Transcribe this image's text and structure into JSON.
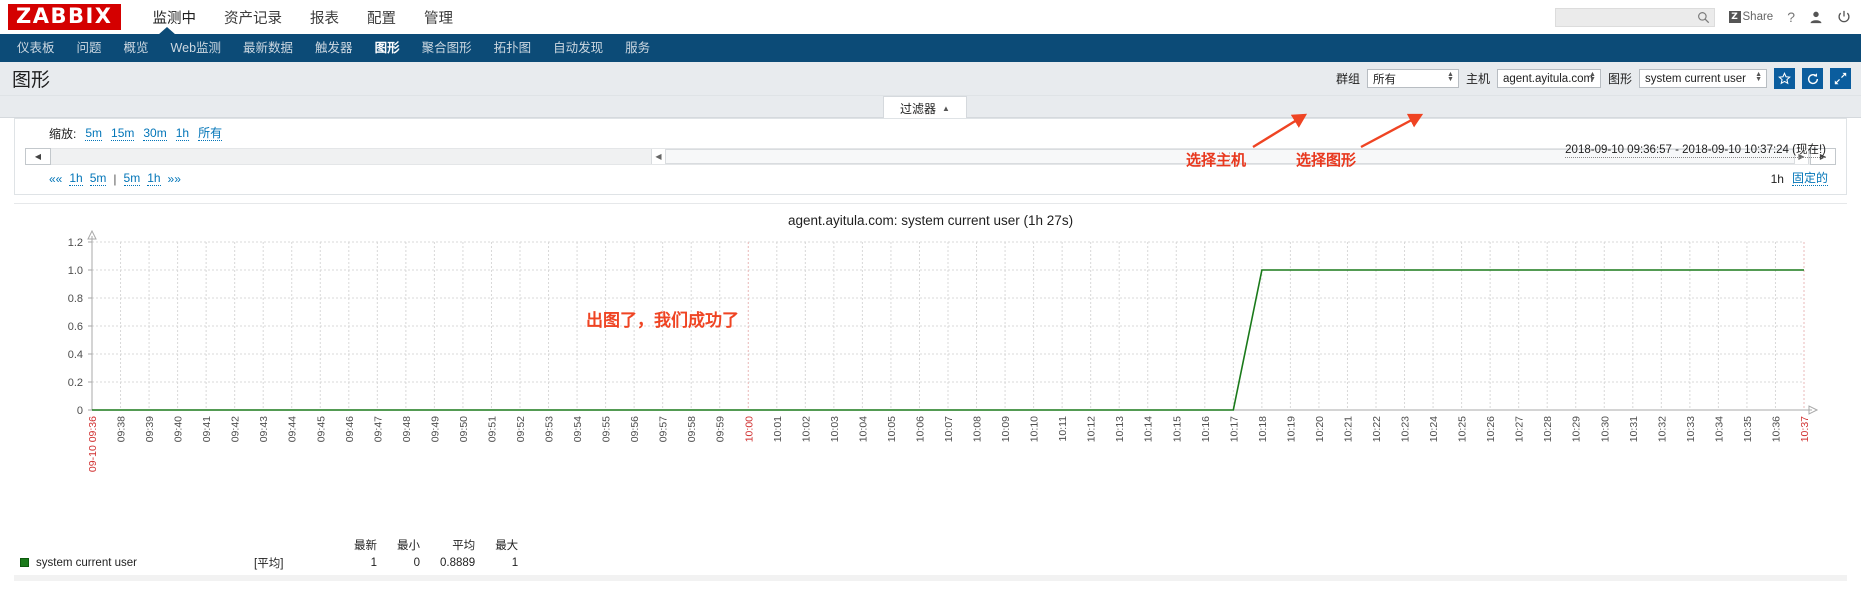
{
  "header": {
    "logo": "ZABBIX",
    "menu": [
      {
        "label": "监测中",
        "active": true
      },
      {
        "label": "资产记录",
        "active": false
      },
      {
        "label": "报表",
        "active": false
      },
      {
        "label": "配置",
        "active": false
      },
      {
        "label": "管理",
        "active": false
      }
    ],
    "search": {
      "value": "",
      "placeholder": ""
    },
    "share_label": "Share",
    "share_badge": "Z",
    "help_label": "?",
    "icons": {
      "search": "search-icon",
      "user": "user-icon",
      "power": "power-icon"
    }
  },
  "subnav": {
    "items": [
      {
        "label": "仪表板",
        "active": false
      },
      {
        "label": "问题",
        "active": false
      },
      {
        "label": "概览",
        "active": false
      },
      {
        "label": "Web监测",
        "active": false
      },
      {
        "label": "最新数据",
        "active": false
      },
      {
        "label": "触发器",
        "active": false
      },
      {
        "label": "图形",
        "active": true
      },
      {
        "label": "聚合图形",
        "active": false
      },
      {
        "label": "拓扑图",
        "active": false
      },
      {
        "label": "自动发现",
        "active": false
      },
      {
        "label": "服务",
        "active": false
      }
    ]
  },
  "page": {
    "title": "图形",
    "filters": {
      "group_label": "群组",
      "group_value": "所有",
      "host_label": "主机",
      "host_value": "agent.ayitula.com",
      "graph_label": "图形",
      "graph_value": "system current user"
    },
    "actions": {
      "favorite": "star-icon",
      "refresh": "refresh-icon",
      "fullscreen": "expand-icon"
    }
  },
  "filter_tab": {
    "label": "过滤器",
    "caret": "▲"
  },
  "time_filter": {
    "zoom_label": "缩放:",
    "zoom_options": [
      "5m",
      "15m",
      "30m",
      "1h",
      "所有"
    ],
    "nav_left": [
      "««",
      "1h",
      "5m"
    ],
    "nav_sep": "|",
    "nav_right": [
      "5m",
      "1h",
      "»»"
    ],
    "range_text": "2018-09-10 09:36:57 - 2018-09-10 10:37:24 (现在!)",
    "period_label": "1h",
    "fixed_label": "固定的"
  },
  "annotations": [
    {
      "text": "选择主机",
      "id": "annotation-select-host"
    },
    {
      "text": "选择图形",
      "id": "annotation-select-graph"
    },
    {
      "text": "出图了，我们成功了",
      "id": "annotation-success"
    }
  ],
  "colors": {
    "brand_red": "#d40000",
    "nav_blue": "#0c4b77",
    "accent_blue": "#0b5d9e",
    "line_green": "#1a7a1a",
    "annotation_red": "#ef4423"
  },
  "legend": {
    "columns": [
      "最新",
      "最小",
      "平均",
      "最大"
    ],
    "rows": [
      {
        "name": "system current user",
        "aggregate": "[平均]",
        "last": "1",
        "min": "0",
        "avg": "0.8889",
        "max": "1",
        "color": "#1a7a1a"
      }
    ]
  },
  "chart_data": {
    "type": "line",
    "title": "agent.ayitula.com: system current user (1h 27s)",
    "xlabel": "",
    "ylabel": "",
    "ylim": [
      0,
      1.2
    ],
    "yticks": [
      0,
      0.2,
      0.4,
      0.6,
      0.8,
      1.0,
      1.2
    ],
    "ytick_labels": [
      "0",
      "0.2",
      "0.4",
      "0.6",
      "0.8",
      "1.0",
      "1.2"
    ],
    "grid": true,
    "legend_position": "bottom",
    "x_start_label": "09-10 09:36",
    "xtick_labels": [
      "09-10 09:36",
      "09:38",
      "09:39",
      "09:40",
      "09:41",
      "09:42",
      "09:43",
      "09:44",
      "09:45",
      "09:46",
      "09:47",
      "09:48",
      "09:49",
      "09:50",
      "09:51",
      "09:52",
      "09:53",
      "09:54",
      "09:55",
      "09:56",
      "09:57",
      "09:58",
      "09:59",
      "10:00",
      "10:01",
      "10:02",
      "10:03",
      "10:04",
      "10:05",
      "10:06",
      "10:07",
      "10:08",
      "10:09",
      "10:10",
      "10:11",
      "10:12",
      "10:13",
      "10:14",
      "10:15",
      "10:16",
      "10:17",
      "10:18",
      "10:19",
      "10:20",
      "10:21",
      "10:22",
      "10:23",
      "10:24",
      "10:25",
      "10:26",
      "10:27",
      "10:28",
      "10:29",
      "10:30",
      "10:31",
      "10:32",
      "10:33",
      "10:34",
      "10:35",
      "10:36",
      "10:37"
    ],
    "highlight_ticks": [
      "09-10 09:36",
      "10:00",
      "10:37"
    ],
    "series": [
      {
        "name": "system current user",
        "color": "#1a7a1a",
        "aggregate": "平均",
        "stats": {
          "last": 1,
          "min": 0,
          "avg": 0.8889,
          "max": 1
        },
        "x": [
          "09:36",
          "10:16",
          "10:17",
          "10:18",
          "10:37"
        ],
        "values": [
          0,
          0,
          0,
          1,
          1
        ]
      }
    ]
  }
}
